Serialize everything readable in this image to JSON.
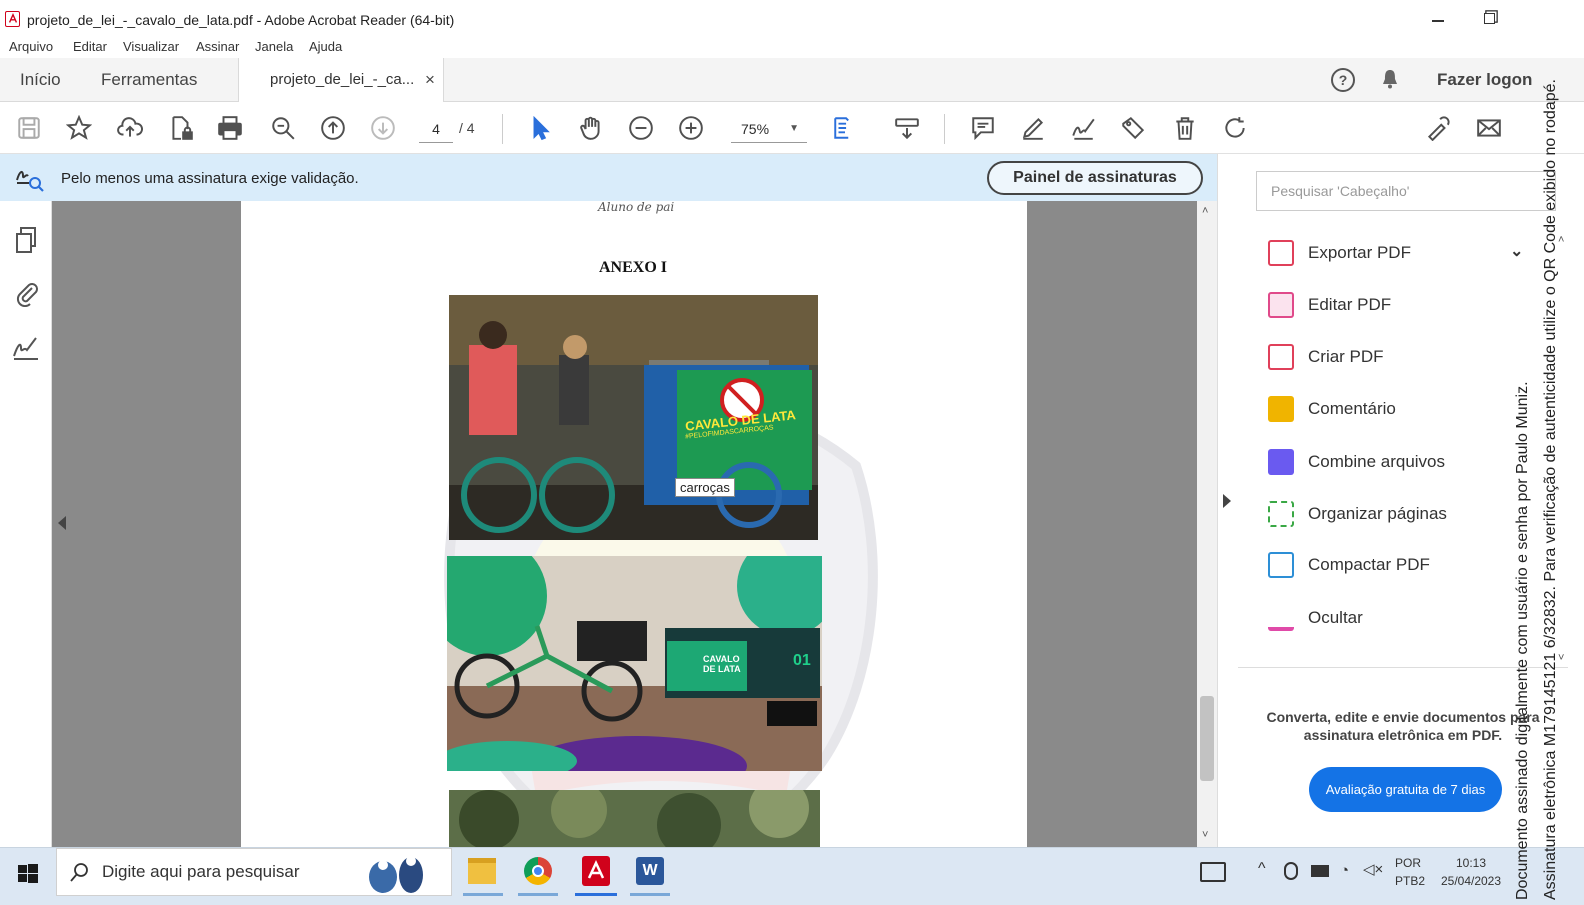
{
  "window": {
    "title": "projeto_de_lei_-_cavalo_de_lata.pdf - Adobe Acrobat Reader (64-bit)"
  },
  "menu": [
    "Arquivo",
    "Editar",
    "Visualizar",
    "Assinar",
    "Janela",
    "Ajuda"
  ],
  "tabs": {
    "home": "Início",
    "tools": "Ferramentas",
    "document": "projeto_de_lei_-_ca...",
    "close": "×",
    "logout": "Fazer logon"
  },
  "toolbar": {
    "page_current": "4",
    "page_total": "/ 4",
    "zoom": "75%"
  },
  "signature_bar": {
    "message": "Pelo menos uma assinatura exige validação.",
    "button": "Painel de assinaturas"
  },
  "document": {
    "handwriting": "Aluno de pai",
    "heading": "ANEXO I",
    "photo1_tooltip": "carroças",
    "photo1_sign1": "CAVALO DE LATA",
    "photo1_sign2": "#PELOFIMDASCARROÇAS",
    "photo2_sign": "CAVALO DE LATA",
    "photo2_num": "01"
  },
  "right_panel": {
    "search_placeholder": "Pesquisar 'Cabeçalho'",
    "tools": [
      {
        "label": "Exportar PDF",
        "color": "#e0405a"
      },
      {
        "label": "Editar PDF",
        "color": "#e04a8a"
      },
      {
        "label": "Criar PDF",
        "color": "#e0405a"
      },
      {
        "label": "Comentário",
        "color": "#f0b400"
      },
      {
        "label": "Combine arquivos",
        "color": "#6a5af0"
      },
      {
        "label": "Organizar páginas",
        "color": "#3aa845"
      },
      {
        "label": "Compactar PDF",
        "color": "#2d8fd6"
      },
      {
        "label": "Ocultar",
        "color": "#e04aa8"
      }
    ],
    "promo_text": "Converta, edite e envie documentos para assinatura eletrônica em PDF.",
    "promo_button": "Avaliação gratuita de 7 dias"
  },
  "taskbar": {
    "search_placeholder": "Digite aqui para pesquisar",
    "lang1": "POR",
    "lang2": "PTB2",
    "time": "10:13",
    "date": "25/04/2023"
  },
  "side_stamp": {
    "line1": "Documento assinado digitalmente com usuário e senha por Paulo Muniz.",
    "line2": "Assinatura eletrônica M179145121 6/32832. Para verificação de autenticidade utilize o QR Code exibido no rodapé."
  }
}
